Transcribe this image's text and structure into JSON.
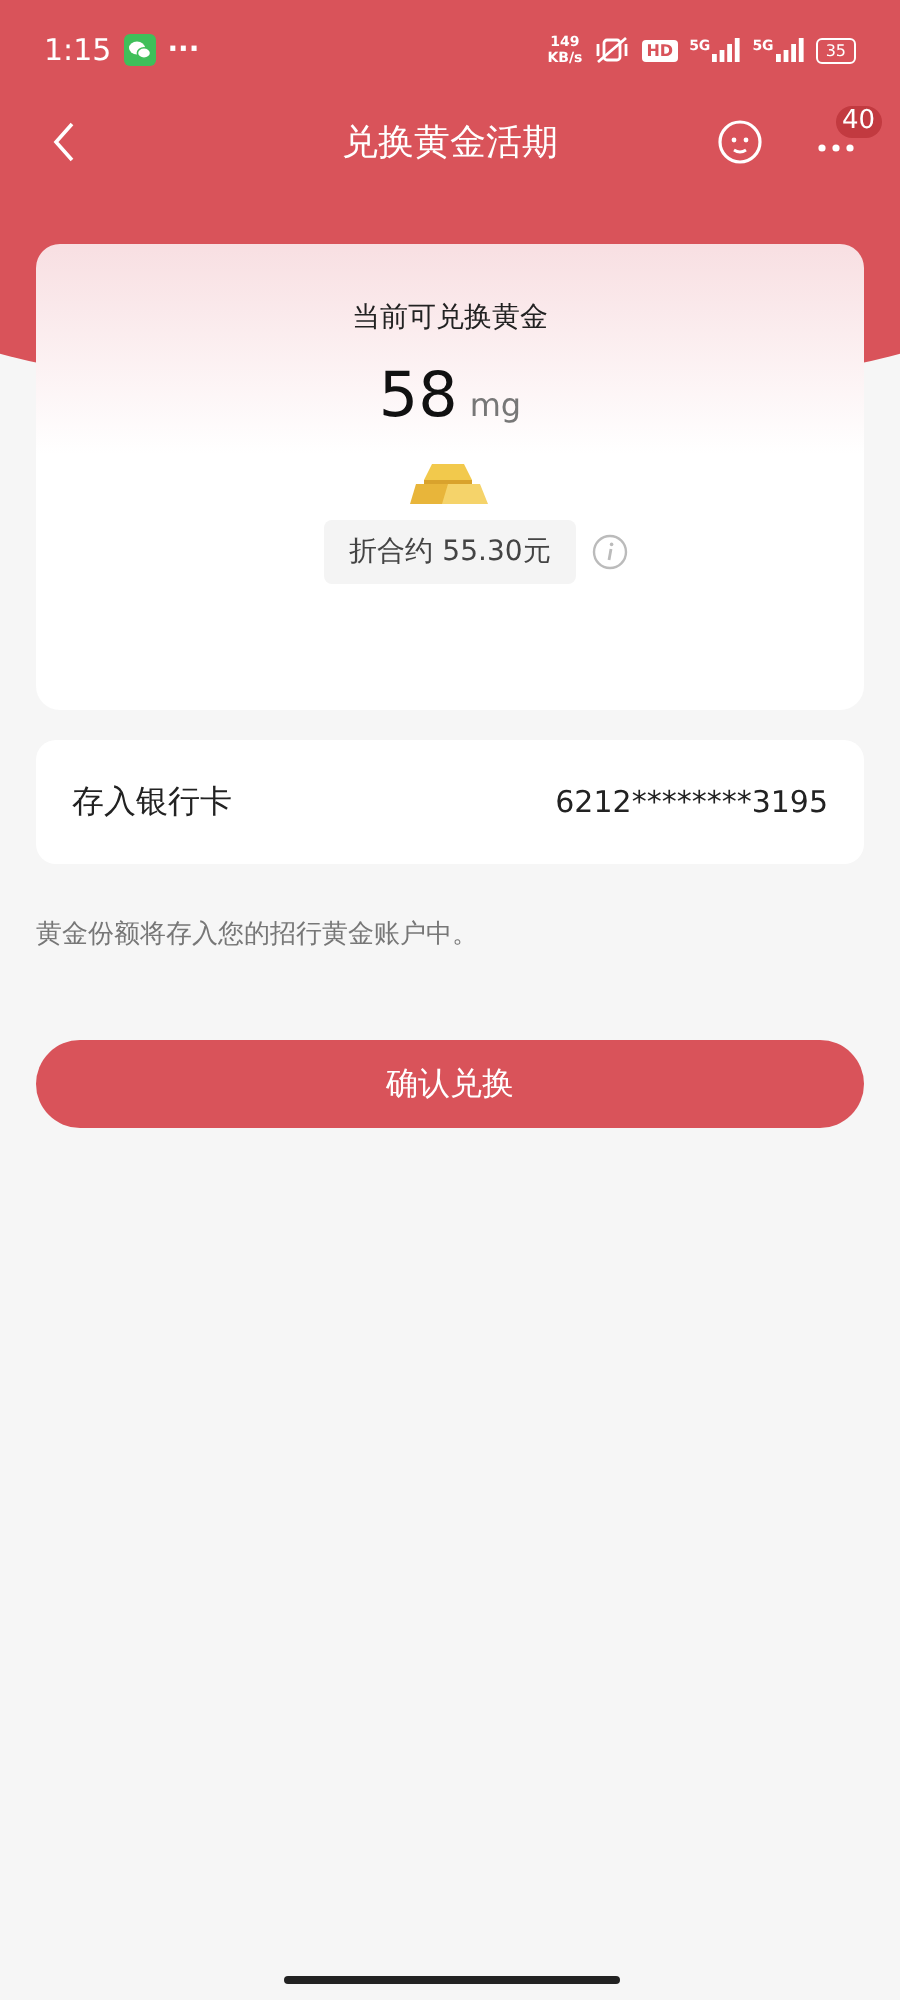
{
  "status_bar": {
    "time": "1:15",
    "notification_more": "···",
    "net_speed": "149",
    "net_unit": "KB/s",
    "hd": "HD",
    "signal_1": "5G",
    "signal_2": "5G",
    "battery": "35"
  },
  "header": {
    "title": "兑换黄金活期",
    "more_badge": "40"
  },
  "gold_card": {
    "label": "当前可兑换黄金",
    "amount": "58",
    "unit": "mg",
    "equivalent": "折合约 55.30元"
  },
  "bank_row": {
    "label": "存入银行卡",
    "value": "6212********3195"
  },
  "note": "黄金份额将存入您的招行黄金账户中。",
  "confirm_button": "确认兑换"
}
